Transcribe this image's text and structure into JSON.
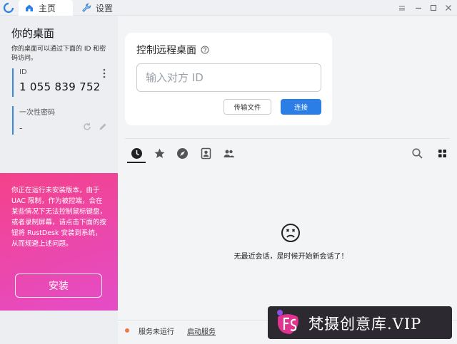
{
  "titlebar": {
    "tabs": [
      {
        "label": "主页",
        "icon": "home-icon",
        "active": true
      },
      {
        "label": "设置",
        "icon": "wrench-icon",
        "active": false
      }
    ],
    "window_controls": [
      "menu-icon",
      "minimize-icon",
      "maximize-icon",
      "close-icon"
    ]
  },
  "left": {
    "title": "你的桌面",
    "description": "你的桌面可以通过下面的 ID 和密码访问。",
    "id_field": {
      "label": "ID",
      "value": "1 055 839 752"
    },
    "password_field": {
      "label": "一次性密码",
      "value": "-"
    },
    "warning": {
      "text": "你正在运行未安装版本，由于 UAC 限制，作为被控端，会在某些情况下无法控制鼠标键盘，或者录制屏幕，请点击下面的按钮将 RustDesk 安装到系统，从而规避上述问题。",
      "install_label": "安装"
    }
  },
  "remote": {
    "title": "控制远程桌面",
    "input_placeholder": "输入对方 ID",
    "transfer_label": "传输文件",
    "connect_label": "连接"
  },
  "session_tabs": [
    "recent-sessions",
    "favorites",
    "discovered",
    "address-book",
    "group"
  ],
  "empty_state": {
    "text": "无最近会话，是时候开始新会话了！"
  },
  "status": {
    "text": "服务未运行",
    "link": "启动服务"
  },
  "watermark": {
    "text": "梵摄创意库.VIP"
  },
  "colors": {
    "accent": "#2a7ee6",
    "warning_start": "#f4418a",
    "warning_end": "#e44dc8",
    "status_dot": "#f07b3f"
  }
}
